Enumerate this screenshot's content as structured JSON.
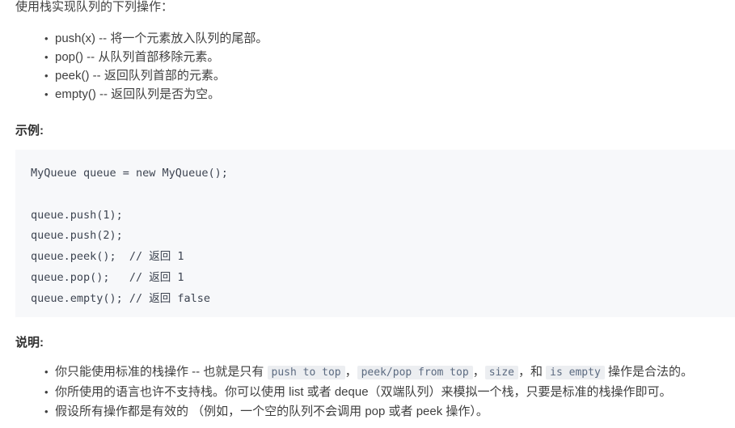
{
  "intro": "使用栈实现队列的下列操作：",
  "operations": {
    "items": [
      "push(x) -- 将一个元素放入队列的尾部。",
      "pop() -- 从队列首部移除元素。",
      "peek() -- 返回队列首部的元素。",
      "empty() -- 返回队列是否为空。"
    ]
  },
  "example": {
    "heading": "示例:",
    "code": "MyQueue queue = new MyQueue();\n\nqueue.push(1);\nqueue.push(2);\nqueue.peek();  // 返回 1\nqueue.pop();   // 返回 1\nqueue.empty(); // 返回 false"
  },
  "notes": {
    "heading": "说明:",
    "items": [
      {
        "parts": [
          {
            "type": "text",
            "value": "你只能使用标准的栈操作 -- 也就是只有 "
          },
          {
            "type": "code",
            "value": "push to top"
          },
          {
            "type": "text",
            "value": "，"
          },
          {
            "type": "code",
            "value": "peek/pop from top"
          },
          {
            "type": "text",
            "value": "，"
          },
          {
            "type": "code",
            "value": "size"
          },
          {
            "type": "text",
            "value": "，和 "
          },
          {
            "type": "code",
            "value": "is empty"
          },
          {
            "type": "text",
            "value": " 操作是合法的。"
          }
        ]
      },
      {
        "parts": [
          {
            "type": "text",
            "value": "你所使用的语言也许不支持栈。你可以使用 list 或者 deque（双端队列）来模拟一个栈，只要是标准的栈操作即可。"
          }
        ]
      },
      {
        "parts": [
          {
            "type": "text",
            "value": "假设所有操作都是有效的 （例如，一个空的队列不会调用 pop 或者 peek 操作）。"
          }
        ]
      }
    ]
  },
  "colors": {
    "text": "#3f3f3f",
    "code_block_bg": "#f7f8fa",
    "code_block_text": "#3d4451",
    "inline_code_bg": "#eceef1",
    "inline_code_text": "#5b6a80"
  }
}
